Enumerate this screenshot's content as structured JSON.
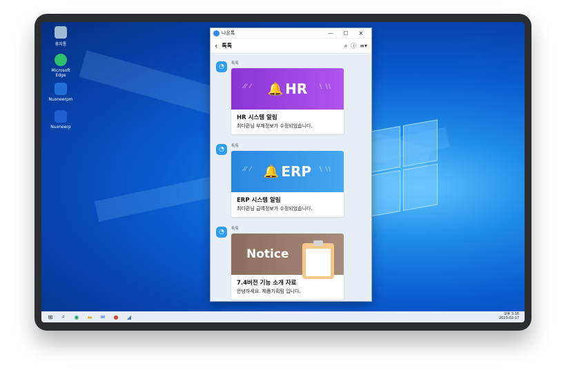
{
  "desktop": {
    "icons": [
      {
        "label": "휴지통",
        "icon": "recycle-bin-icon",
        "color": "#9fb8d6"
      },
      {
        "label": "Microsoft Edge",
        "icon": "edge-icon",
        "color": "#2fbf71"
      },
      {
        "label": "Nuoneerpm",
        "icon": "nuon-icon",
        "color": "#1f6fd6"
      },
      {
        "label": "Nuoneerp",
        "icon": "nuon-m-icon",
        "color": "#1f5fd0"
      }
    ]
  },
  "window": {
    "title": "나온톡",
    "controls": {
      "minimize": "—",
      "maximize": "☐",
      "close": "✕"
    },
    "nav": {
      "back": "‹",
      "title": "톡톡",
      "search": "⌕",
      "info": "ⓘ",
      "menu": "≡▾"
    }
  },
  "messages": [
    {
      "sender": "톡톡",
      "banner_text": "HR",
      "banner_color": "#9b3fe0",
      "title": "HR 시스템 알림",
      "body": "최다환님 부재정보가 수정되었습니다."
    },
    {
      "sender": "톡톡",
      "banner_text": "ERP",
      "banner_color": "#2f95e6",
      "title": "ERP 시스템 알림",
      "body": "최다환님 급여정보가 수정되었습니다."
    },
    {
      "sender": "톡톡",
      "banner_text": "Notice",
      "banner_color": "#8b6d5d",
      "title": "7.4버전 기능 소개 자료",
      "body": "안녕하세요. 제품기획팀 입니다."
    }
  ],
  "taskbar": {
    "items": [
      "windows-start-icon",
      "search-icon",
      "edge-icon",
      "file-explorer-icon",
      "mail-icon",
      "powerpoint-icon",
      "app-icon"
    ],
    "time": "오후 3:18",
    "date": "2023-02-17"
  }
}
